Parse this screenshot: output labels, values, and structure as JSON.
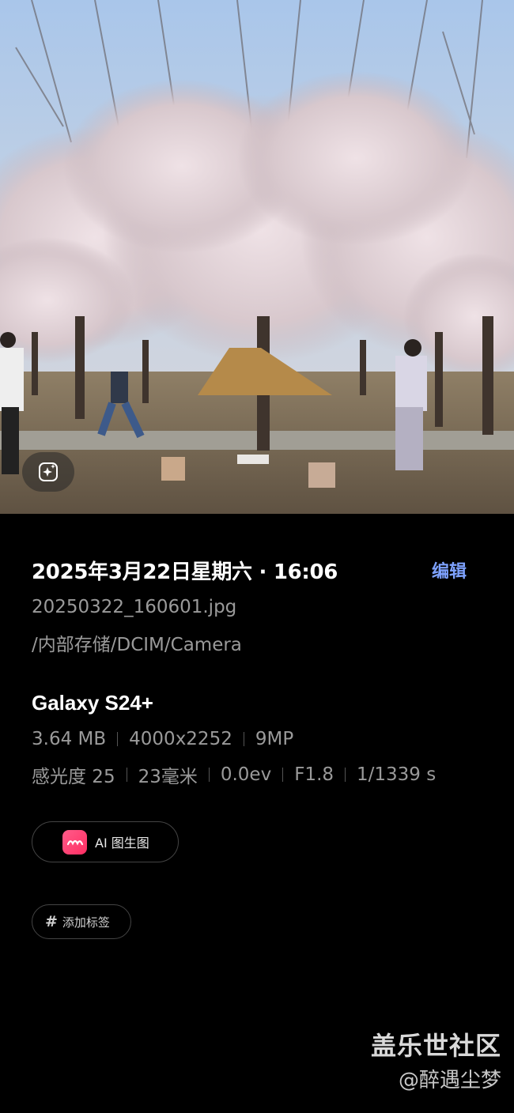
{
  "photo": {
    "icons": {
      "enhance": "ai-sparkle-icon"
    }
  },
  "details": {
    "datetime": "2025年3月22日星期六 · 16:06",
    "edit_label": "编辑",
    "filename": "20250322_160601.jpg",
    "path": "/内部存储/DCIM/Camera",
    "device": "Galaxy S24+",
    "meta_row1": [
      "3.64 MB",
      "4000x2252",
      "9MP"
    ],
    "meta_row2": [
      "感光度 25",
      "23毫米",
      "0.0ev",
      "F1.8",
      "1/1339 s"
    ],
    "ai_button_label": "AI 图生图",
    "tag_button_label": "添加标签",
    "accent_color": "#7ea2ff",
    "ai_logo_color": "#ff3f72"
  },
  "watermark": {
    "title": "盖乐世社区",
    "author": "@醉遇尘梦"
  }
}
